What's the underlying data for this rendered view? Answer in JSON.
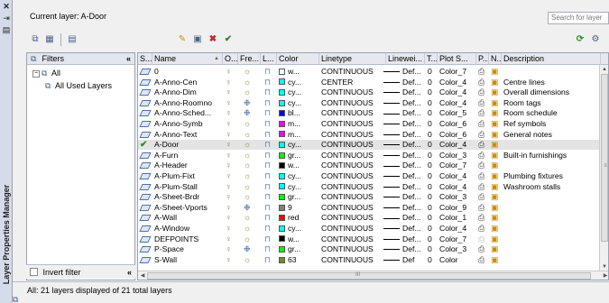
{
  "window": {
    "side_title": "Layer Properties Manager",
    "close_glyph": "✕",
    "pin_glyph": "⇥",
    "menu_glyph": "▤"
  },
  "header": {
    "current_layer": "Current layer: A-Door",
    "search_placeholder": "Search for layer"
  },
  "toolbar": {
    "left": [
      {
        "name": "new-property-filter-icon",
        "glyph": "⧉"
      },
      {
        "name": "new-group-filter-icon",
        "glyph": "▦"
      },
      {
        "name": "layer-states-manager-icon",
        "glyph": "▤"
      }
    ],
    "mid": [
      {
        "name": "new-layer-icon",
        "glyph": "✎",
        "cls": "star"
      },
      {
        "name": "new-vp-frozen-layer-icon",
        "glyph": "▣"
      },
      {
        "name": "delete-layer-icon",
        "glyph": "✖",
        "cls": "red"
      },
      {
        "name": "set-current-icon",
        "glyph": "✔",
        "cls": "green"
      }
    ],
    "right": [
      {
        "name": "refresh-icon",
        "glyph": "⟳",
        "cls": "green"
      },
      {
        "name": "settings-icon",
        "glyph": "⚙"
      }
    ]
  },
  "filters": {
    "header": "Filters",
    "collapse": "«",
    "tree": [
      {
        "label": "All",
        "expand": "−",
        "depth": 0
      },
      {
        "label": "All Used Layers",
        "depth": 1
      }
    ],
    "invert_label": "Invert filter",
    "invert_collapse": "«"
  },
  "table": {
    "columns": [
      "S...",
      "Name",
      "O...",
      "Fre...",
      "L...",
      "Color",
      "Linetype",
      "Linewei...",
      "T...",
      "Plot S...",
      "P...",
      "N...",
      "Description"
    ],
    "sort_indicator": "▲",
    "rows": [
      {
        "name": "0",
        "color_hex": "#ffffff",
        "color": "w...",
        "linetype": "CONTINUOUS",
        "lw": "Def...",
        "t": "0",
        "plot_style": "Color_7",
        "desc": "",
        "current": false,
        "frozen_icon": false,
        "plot": true
      },
      {
        "name": "A-Anno-Cen",
        "color_hex": "#00ffff",
        "color": "cy...",
        "linetype": "CENTER",
        "lw": "Def...",
        "t": "0",
        "plot_style": "Color_4",
        "desc": "Centre lines",
        "current": false,
        "frozen_icon": false,
        "plot": true
      },
      {
        "name": "A-Anno-Dim",
        "color_hex": "#00ffff",
        "color": "cy...",
        "linetype": "CONTINUOUS",
        "lw": "Def...",
        "t": "0",
        "plot_style": "Color_4",
        "desc": "Overall dimensions",
        "current": false,
        "frozen_icon": false,
        "plot": true
      },
      {
        "name": "A-Anno-Roomno",
        "color_hex": "#00ffff",
        "color": "cy...",
        "linetype": "CONTINUOUS",
        "lw": "Def...",
        "t": "0",
        "plot_style": "Color_4",
        "desc": "Room tags",
        "current": false,
        "frozen_icon": true,
        "plot": true
      },
      {
        "name": "A-Anno-Sched...",
        "color_hex": "#0000ff",
        "color": "bl...",
        "linetype": "CONTINUOUS",
        "lw": "Def...",
        "t": "0",
        "plot_style": "Color_5",
        "desc": "Room schedule",
        "current": false,
        "frozen_icon": true,
        "plot": true
      },
      {
        "name": "A-Anno-Symb",
        "color_hex": "#ff00ff",
        "color": "m...",
        "linetype": "CONTINUOUS",
        "lw": "Def...",
        "t": "0",
        "plot_style": "Color_6",
        "desc": "Ref symbols",
        "current": false,
        "frozen_icon": false,
        "plot": true
      },
      {
        "name": "A-Anno-Text",
        "color_hex": "#ff00ff",
        "color": "m...",
        "linetype": "CONTINUOUS",
        "lw": "Def...",
        "t": "0",
        "plot_style": "Color_6",
        "desc": "General notes",
        "current": false,
        "frozen_icon": false,
        "plot": true
      },
      {
        "name": "A-Door",
        "color_hex": "#00ffff",
        "color": "cy...",
        "linetype": "CONTINUOUS",
        "lw": "Def...",
        "t": "0",
        "plot_style": "Color_4",
        "desc": "",
        "current": true,
        "frozen_icon": false,
        "plot": true
      },
      {
        "name": "A-Furn",
        "color_hex": "#00ff00",
        "color": "gr...",
        "linetype": "CONTINUOUS",
        "lw": "Def...",
        "t": "0",
        "plot_style": "Color_3",
        "desc": "Built-in furnishings",
        "current": false,
        "frozen_icon": false,
        "plot": true
      },
      {
        "name": "A-Header",
        "color_hex": "#000000",
        "color": "w...",
        "linetype": "CONTINUOUS",
        "lw": "Def...",
        "t": "0",
        "plot_style": "Color_7",
        "desc": "",
        "current": false,
        "frozen_icon": false,
        "plot": true
      },
      {
        "name": "A-Plum-Fixt",
        "color_hex": "#00ffff",
        "color": "cy...",
        "linetype": "CONTINUOUS",
        "lw": "Def...",
        "t": "0",
        "plot_style": "Color_4",
        "desc": "Plumbing fixtures",
        "current": false,
        "frozen_icon": false,
        "plot": true
      },
      {
        "name": "A-Plum-Stall",
        "color_hex": "#00ffff",
        "color": "cy...",
        "linetype": "CONTINUOUS",
        "lw": "Def...",
        "t": "0",
        "plot_style": "Color_4",
        "desc": "Washroom stalls",
        "current": false,
        "frozen_icon": false,
        "plot": true
      },
      {
        "name": "A-Sheet-Brdr",
        "color_hex": "#00ff00",
        "color": "gr...",
        "linetype": "CONTINUOUS",
        "lw": "Def...",
        "t": "0",
        "plot_style": "Color_3",
        "desc": "",
        "current": false,
        "frozen_icon": false,
        "plot": true
      },
      {
        "name": "A-Sheet-Vports",
        "color_hex": "#808080",
        "color": "9",
        "linetype": "CONTINUOUS",
        "lw": "Def...",
        "t": "0",
        "plot_style": "Color_9",
        "desc": "",
        "current": false,
        "frozen_icon": true,
        "plot": true
      },
      {
        "name": "A-Wall",
        "color_hex": "#ff0000",
        "color": "red",
        "linetype": "CONTINUOUS",
        "lw": "Def...",
        "t": "0",
        "plot_style": "Color_1",
        "desc": "",
        "current": false,
        "frozen_icon": false,
        "plot": true
      },
      {
        "name": "A-Window",
        "color_hex": "#00ffff",
        "color": "cy...",
        "linetype": "CONTINUOUS",
        "lw": "Def...",
        "t": "0",
        "plot_style": "Color_4",
        "desc": "",
        "current": false,
        "frozen_icon": false,
        "plot": true
      },
      {
        "name": "DEFPOINTS",
        "color_hex": "#000000",
        "color": "w...",
        "linetype": "CONTINUOUS",
        "lw": "Def...",
        "t": "0",
        "plot_style": "Color_7",
        "desc": "",
        "current": false,
        "frozen_icon": false,
        "plot": false
      },
      {
        "name": "P-Space",
        "color_hex": "#00ff00",
        "color": "gr...",
        "linetype": "CONTINUOUS",
        "lw": "Def...",
        "t": "0",
        "plot_style": "Color_3",
        "desc": "",
        "current": false,
        "frozen_icon": true,
        "plot": true
      },
      {
        "name": "S-Wall",
        "color_hex": "#6b8e23",
        "color": "63",
        "linetype": "CONTINUOUS",
        "lw": "Def",
        "t": "0",
        "plot_style": "Color",
        "desc": "",
        "current": false,
        "frozen_icon": false,
        "plot": true
      }
    ]
  },
  "scroll": {
    "up": "▲",
    "down": "▼",
    "left": "◀",
    "right": "▶",
    "grip_v": "≡",
    "grip_h": "III"
  },
  "status": {
    "text": "All: 21 layers displayed of 21 total layers",
    "icon_glyph": "⧉"
  }
}
